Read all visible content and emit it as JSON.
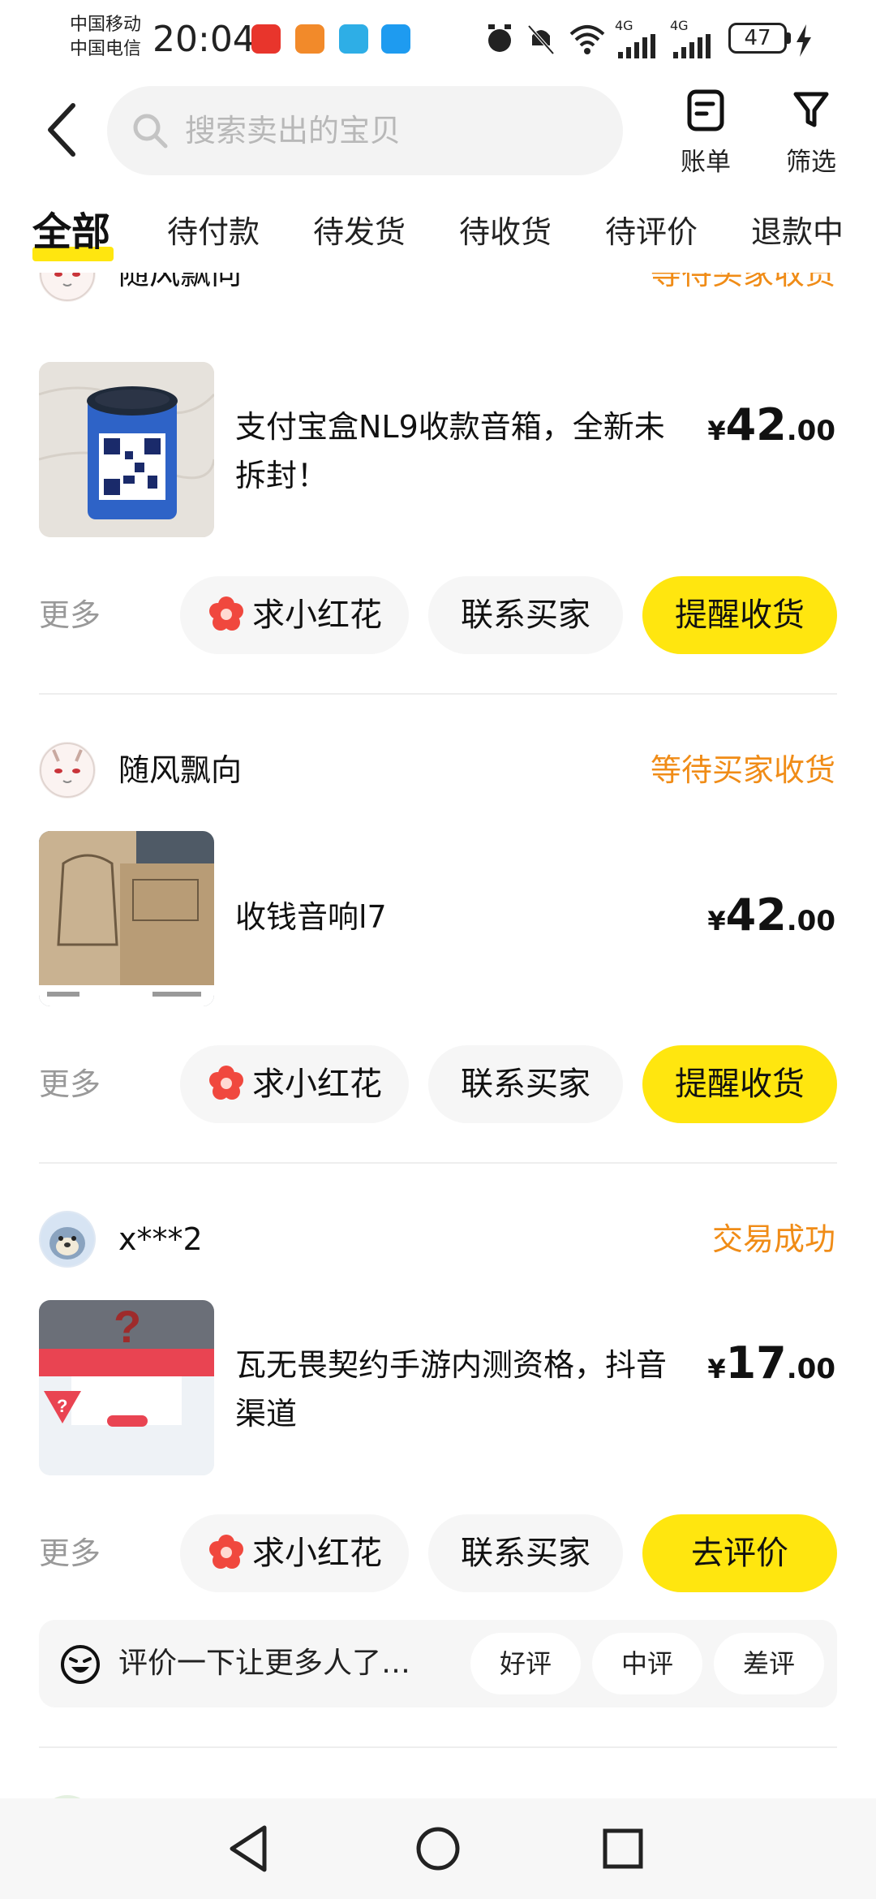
{
  "status_bar": {
    "carrier1": "中国移动",
    "carrier2": "中国电信",
    "time": "20:04",
    "battery": "47",
    "net1": "4G",
    "net2": "4G"
  },
  "header": {
    "search_placeholder": "搜索卖出的宝贝",
    "bill_label": "账单",
    "filter_label": "筛选"
  },
  "tabs": [
    "全部",
    "待付款",
    "待发货",
    "待收货",
    "待评价",
    "退款中"
  ],
  "orders": [
    {
      "seller": "随风飘向",
      "status": "等待买家收货",
      "title": "支付宝盒NL9收款音箱，全新未拆封！",
      "price_currency": "¥",
      "price_int": "42",
      "price_dec": ".00",
      "more": "更多",
      "btn_flower": "求小红花",
      "btn_contact": "联系买家",
      "btn_primary": "提醒收货"
    },
    {
      "seller": "随风飘向",
      "status": "等待买家收货",
      "title": "收钱音响l7",
      "price_currency": "¥",
      "price_int": "42",
      "price_dec": ".00",
      "more": "更多",
      "btn_flower": "求小红花",
      "btn_contact": "联系买家",
      "btn_primary": "提醒收货"
    },
    {
      "seller": "x***2",
      "status": "交易成功",
      "title": "瓦无畏契约手游内测资格，抖音渠道",
      "price_currency": "¥",
      "price_int": "17",
      "price_dec": ".00",
      "more": "更多",
      "btn_flower": "求小红花",
      "btn_contact": "联系买家",
      "btn_primary": "去评价",
      "review_prompt": "评价一下让更多人了…",
      "review_options": [
        "好评",
        "中评",
        "差评"
      ]
    }
  ],
  "colors": {
    "accent_yellow": "#ffe60f",
    "status_orange": "#f08c17",
    "flower_red": "#f0483e"
  }
}
